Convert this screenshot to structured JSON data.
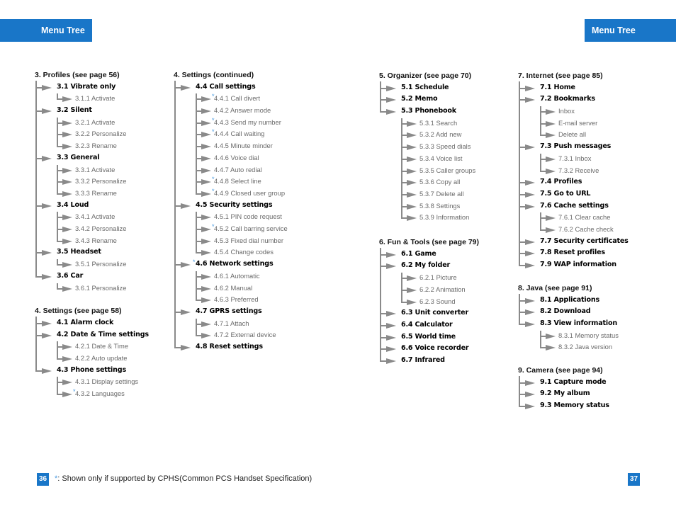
{
  "header": {
    "left_title": "Menu Tree",
    "right_title": "Menu Tree"
  },
  "footer": {
    "left_page": "36",
    "right_page": "37",
    "note_symbol": "*",
    "note_text": ": Shown only if supported by CPHS(Common PCS Handset Specification)"
  },
  "accent_color": "#1976c8",
  "columns": [
    {
      "sections": [
        {
          "title": "3.  Profiles (see page 56)",
          "items": [
            {
              "label": "3.1 Vibrate only",
              "children": [
                {
                  "label": "3.1.1 Activate"
                }
              ]
            },
            {
              "label": "3.2 Silent",
              "children": [
                {
                  "label": "3.2.1 Activate"
                },
                {
                  "label": "3.2.2 Personalize"
                },
                {
                  "label": "3.2.3 Rename"
                }
              ]
            },
            {
              "label": "3.3 General",
              "children": [
                {
                  "label": "3.3.1 Activate"
                },
                {
                  "label": "3.3.2 Personalize"
                },
                {
                  "label": "3.3.3 Rename"
                }
              ]
            },
            {
              "label": "3.4 Loud",
              "children": [
                {
                  "label": "3.4.1 Activate"
                },
                {
                  "label": "3.4.2 Personalize"
                },
                {
                  "label": "3.4.3 Rename"
                }
              ]
            },
            {
              "label": "3.5 Headset",
              "children": [
                {
                  "label": "3.5.1 Personalize"
                }
              ]
            },
            {
              "label": "3.6 Car",
              "children": [
                {
                  "label": "3.6.1 Personalize"
                }
              ]
            }
          ]
        },
        {
          "title": "4.  Settings (see page 58)",
          "items": [
            {
              "label": "4.1 Alarm clock",
              "children": []
            },
            {
              "label": "4.2 Date & Time settings",
              "children": [
                {
                  "label": "4.2.1 Date & Time"
                },
                {
                  "label": "4.2.2 Auto update"
                }
              ]
            },
            {
              "label": "4.3 Phone settings",
              "children": [
                {
                  "label": "4.3.1 Display settings"
                },
                {
                  "label": "4.3.2 Languages",
                  "cphs": true
                }
              ]
            }
          ]
        }
      ]
    },
    {
      "sections": [
        {
          "title": "4.  Settings (continued)",
          "items": [
            {
              "label": "4.4 Call settings",
              "children": [
                {
                  "label": "4.4.1 Call divert",
                  "cphs": true
                },
                {
                  "label": "4.4.2 Answer mode"
                },
                {
                  "label": "4.4.3 Send my number",
                  "cphs": true
                },
                {
                  "label": "4.4.4 Call waiting",
                  "cphs": true
                },
                {
                  "label": "4.4.5 Minute minder"
                },
                {
                  "label": "4.4.6 Voice dial"
                },
                {
                  "label": "4.4.7 Auto redial"
                },
                {
                  "label": "4.4.8 Select line",
                  "cphs": true
                },
                {
                  "label": "4.4.9 Closed user group",
                  "cphs": true
                }
              ]
            },
            {
              "label": "4.5 Security settings",
              "children": [
                {
                  "label": "4.5.1 PIN code request"
                },
                {
                  "label": "4.5.2 Call barring service",
                  "cphs": true
                },
                {
                  "label": "4.5.3 Fixed dial number"
                },
                {
                  "label": "4.5.4 Change codes"
                }
              ]
            },
            {
              "label": "4.6 Network settings",
              "cphs": true,
              "children": [
                {
                  "label": "4.6.1 Automatic"
                },
                {
                  "label": "4.6.2 Manual"
                },
                {
                  "label": "4.6.3 Preferred"
                }
              ]
            },
            {
              "label": "4.7 GPRS settings",
              "children": [
                {
                  "label": "4.7.1 Attach"
                },
                {
                  "label": "4.7.2 External device"
                }
              ]
            },
            {
              "label": "4.8 Reset settings",
              "children": []
            }
          ]
        }
      ]
    },
    {
      "sections": [
        {
          "title": "5.  Organizer (see page 70)",
          "items": [
            {
              "label": "5.1 Schedule",
              "children": []
            },
            {
              "label": "5.2 Memo",
              "children": []
            },
            {
              "label": "5.3 Phonebook",
              "children": [
                {
                  "label": "5.3.1 Search"
                },
                {
                  "label": "5.3.2 Add new"
                },
                {
                  "label": "5.3.3 Speed dials"
                },
                {
                  "label": "5.3.4 Voice list"
                },
                {
                  "label": "5.3.5 Caller groups"
                },
                {
                  "label": "5.3.6 Copy all"
                },
                {
                  "label": "5.3.7 Delete all"
                },
                {
                  "label": "5.3.8 Settings"
                },
                {
                  "label": "5.3.9 Information"
                }
              ]
            }
          ]
        },
        {
          "title": "6.  Fun & Tools (see page 79)",
          "items": [
            {
              "label": "6.1 Game",
              "children": []
            },
            {
              "label": "6.2 My folder",
              "children": [
                {
                  "label": "6.2.1 Picture"
                },
                {
                  "label": "6.2.2 Animation"
                },
                {
                  "label": "6.2.3 Sound"
                }
              ]
            },
            {
              "label": "6.3 Unit converter",
              "children": []
            },
            {
              "label": "6.4 Calculator",
              "children": []
            },
            {
              "label": "6.5 World time",
              "children": []
            },
            {
              "label": "6.6 Voice recorder",
              "children": []
            },
            {
              "label": "6.7 Infrared",
              "children": []
            }
          ]
        }
      ]
    },
    {
      "sections": [
        {
          "title": "7.  Internet (see page 85)",
          "items": [
            {
              "label": "7.1 Home",
              "children": []
            },
            {
              "label": "7.2 Bookmarks",
              "children": [
                {
                  "label": "Inbox"
                },
                {
                  "label": "E-mail server"
                },
                {
                  "label": "Delete all"
                }
              ]
            },
            {
              "label": "7.3 Push messages",
              "children": [
                {
                  "label": "7.3.1 Inbox"
                },
                {
                  "label": "7.3.2 Receive"
                }
              ]
            },
            {
              "label": "7.4 Profiles",
              "children": []
            },
            {
              "label": "7.5 Go to URL",
              "children": []
            },
            {
              "label": "7.6 Cache settings",
              "children": [
                {
                  "label": "7.6.1 Clear cache"
                },
                {
                  "label": "7.6.2 Cache check"
                }
              ]
            },
            {
              "label": "7.7 Security certificates",
              "children": []
            },
            {
              "label": "7.8 Reset profiles",
              "children": []
            },
            {
              "label": "7.9 WAP information",
              "children": []
            }
          ]
        },
        {
          "title": "8.  Java (see page 91)",
          "items": [
            {
              "label": "8.1 Applications",
              "children": []
            },
            {
              "label": "8.2 Download",
              "children": []
            },
            {
              "label": "8.3 View information",
              "children": [
                {
                  "label": "8.3.1 Memory status"
                },
                {
                  "label": "8.3.2 Java version"
                }
              ]
            }
          ]
        },
        {
          "title": "9.  Camera (see page 94)",
          "items": [
            {
              "label": "9.1 Capture mode",
              "children": []
            },
            {
              "label": "9.2 My album",
              "children": []
            },
            {
              "label": "9.3 Memory status",
              "children": []
            }
          ]
        }
      ]
    }
  ]
}
